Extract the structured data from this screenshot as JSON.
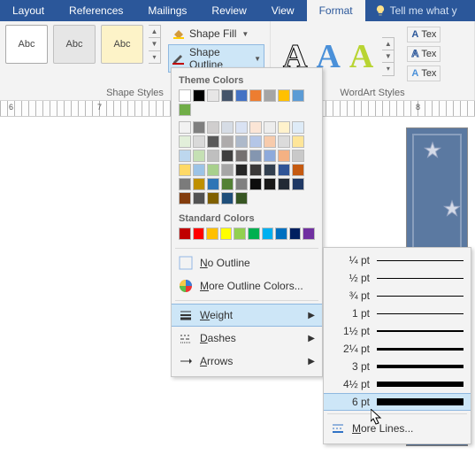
{
  "tabs": [
    "Layout",
    "References",
    "Mailings",
    "Review",
    "View",
    "Format"
  ],
  "active_tab_index": 5,
  "tellme": "Tell me what y",
  "shape_styles": {
    "group_label": "Shape Styles",
    "thumb_text": "Abc",
    "fill_label": "Shape Fill",
    "outline_label": "Shape Outline"
  },
  "wordart": {
    "group_label": "WordArt Styles",
    "letter": "A",
    "tex_label": "Tex"
  },
  "ruler_numbers": [
    "6",
    "7",
    "8"
  ],
  "outline_menu": {
    "theme_heading": "Theme Colors",
    "standard_heading": "Standard Colors",
    "theme_colors_row": [
      "#ffffff",
      "#000000",
      "#e7e6e6",
      "#44546a",
      "#4472c4",
      "#ed7d31",
      "#a5a5a5",
      "#ffc000",
      "#5b9bd5",
      "#70ad47"
    ],
    "theme_shades": [
      [
        "#f2f2f2",
        "#7f7f7f",
        "#d0cece",
        "#d6dce5",
        "#d9e2f3",
        "#fbe5d6",
        "#ededed",
        "#fff2cc",
        "#deebf7",
        "#e2efda"
      ],
      [
        "#d9d9d9",
        "#595959",
        "#aeabab",
        "#adb9ca",
        "#b4c6e7",
        "#f7cbac",
        "#dbdbdb",
        "#fee599",
        "#bdd7ee",
        "#c5e0b4"
      ],
      [
        "#bfbfbf",
        "#404040",
        "#757171",
        "#8496b0",
        "#8eaadb",
        "#f4b183",
        "#c9c9c9",
        "#ffd966",
        "#9cc3e6",
        "#a8d08d"
      ],
      [
        "#a6a6a6",
        "#262626",
        "#3a3838",
        "#323f4f",
        "#2f5496",
        "#c55a11",
        "#7b7b7b",
        "#bf9000",
        "#2e75b6",
        "#538135"
      ],
      [
        "#808080",
        "#0d0d0d",
        "#171717",
        "#222a35",
        "#1f3864",
        "#833c0c",
        "#525252",
        "#806000",
        "#1f4e79",
        "#375623"
      ]
    ],
    "standard_colors": [
      "#c00000",
      "#ff0000",
      "#ffc000",
      "#ffff00",
      "#92d050",
      "#00b050",
      "#00b0f0",
      "#0070c0",
      "#002060",
      "#7030a0"
    ],
    "no_outline": "No Outline",
    "more_colors": "More Outline Colors...",
    "weight": "Weight",
    "dashes": "Dashes",
    "arrows": "Arrows"
  },
  "weight_flyout": {
    "options": [
      {
        "label": "¼ pt",
        "px": 1
      },
      {
        "label": "½ pt",
        "px": 1
      },
      {
        "label": "¾ pt",
        "px": 1
      },
      {
        "label": "1 pt",
        "px": 1.5
      },
      {
        "label": "1½ pt",
        "px": 2
      },
      {
        "label": "2¼ pt",
        "px": 3
      },
      {
        "label": "3 pt",
        "px": 4
      },
      {
        "label": "4½ pt",
        "px": 6
      },
      {
        "label": "6 pt",
        "px": 8
      }
    ],
    "hover_index": 8,
    "more_lines": "More Lines..."
  }
}
